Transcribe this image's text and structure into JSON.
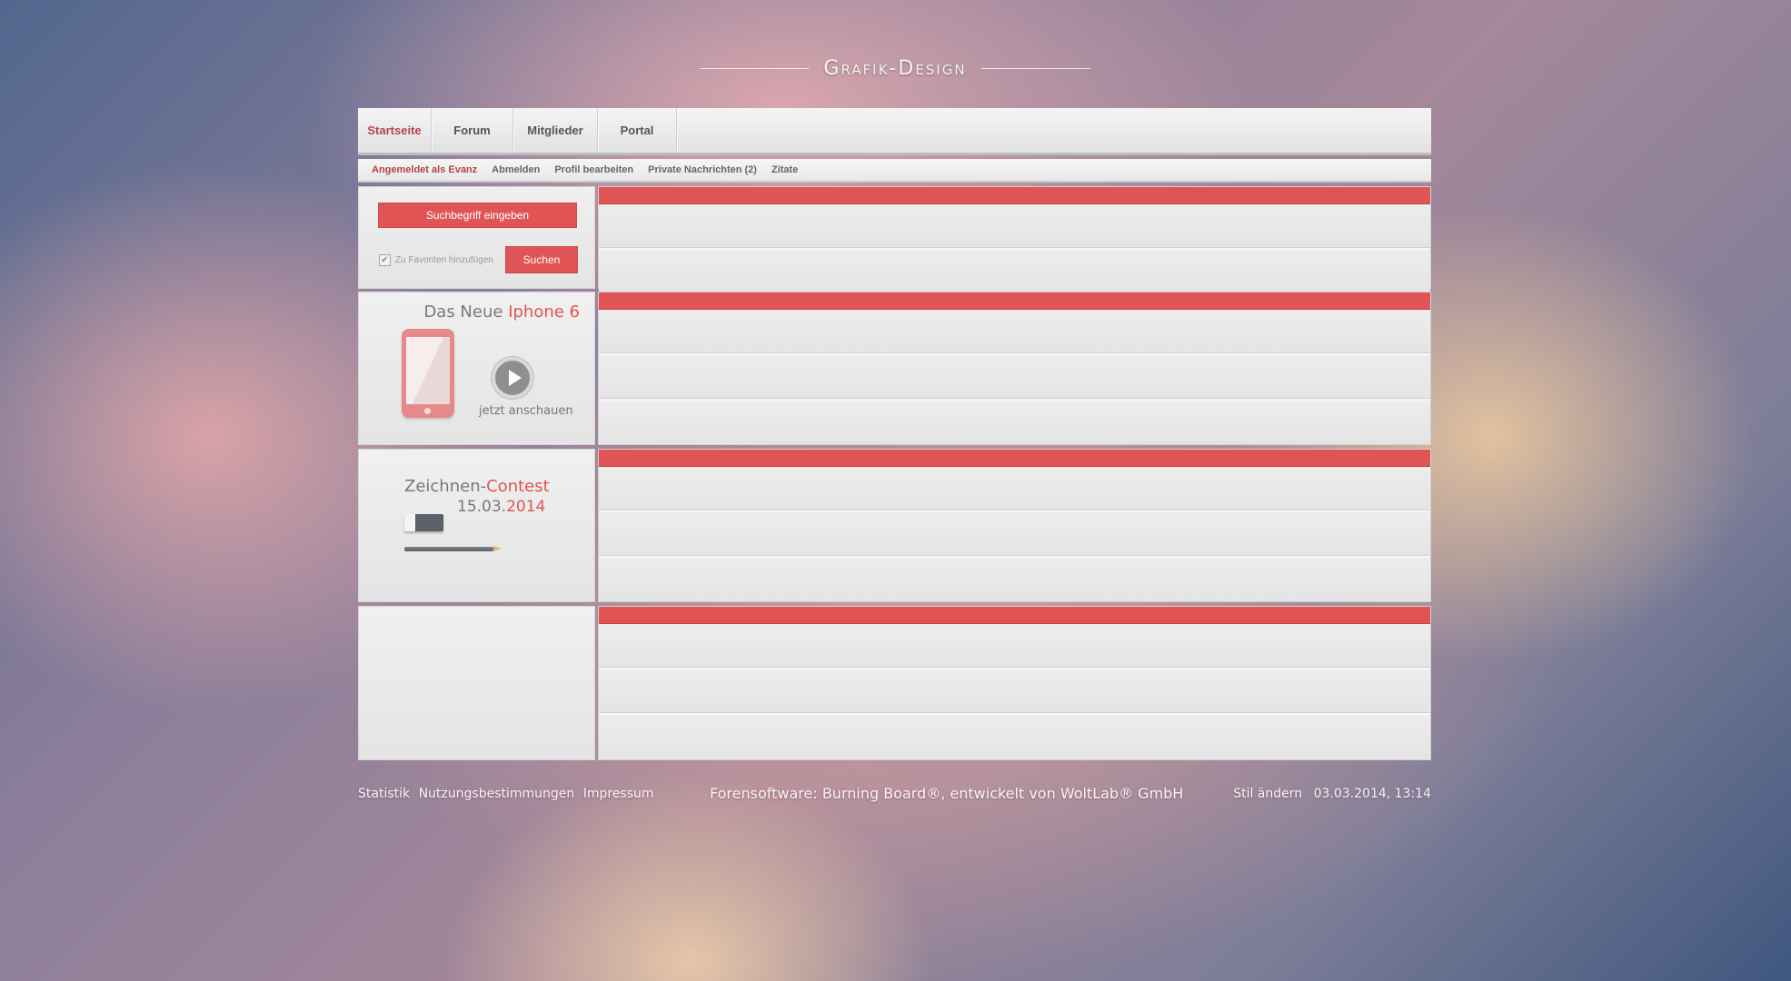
{
  "site": {
    "title": "Grafik-Design"
  },
  "nav": {
    "tabs": [
      {
        "label": "Startseite"
      },
      {
        "label": "Forum"
      },
      {
        "label": "Mitglieder"
      },
      {
        "label": "Portal"
      }
    ]
  },
  "usernav": {
    "logged_in": "Angemeldet als Evanz",
    "logout": "Abmelden",
    "edit_profile": "Profil bearbeiten",
    "messages": "Private Nachrichten (2)",
    "quotes": "Zitate"
  },
  "search": {
    "placeholder": "Suchbegriff eingeben",
    "favorite_label": "Zu Favoriten hinzufügen",
    "favorite_checked": true,
    "button": "Suchen"
  },
  "promo": {
    "title_prefix": "Das Neue",
    "title_highlight": "Iphone 6",
    "watch_label": "jetzt anschauen"
  },
  "contest": {
    "title_prefix": "Zeichnen-",
    "title_highlight": "Contest",
    "date_prefix": "15.03.",
    "date_highlight": "2014"
  },
  "footer": {
    "links": [
      "Statistik",
      "Nutzungsbestimmungen",
      "Impressum"
    ],
    "center": "Forensoftware: Burning Board®, entwickelt von WoltLab® GmbH",
    "style_change": "Stil ändern",
    "datetime": "03.03.2014, 13:14"
  },
  "colors": {
    "accent": "#e05455",
    "active_tab": "#b34348"
  }
}
